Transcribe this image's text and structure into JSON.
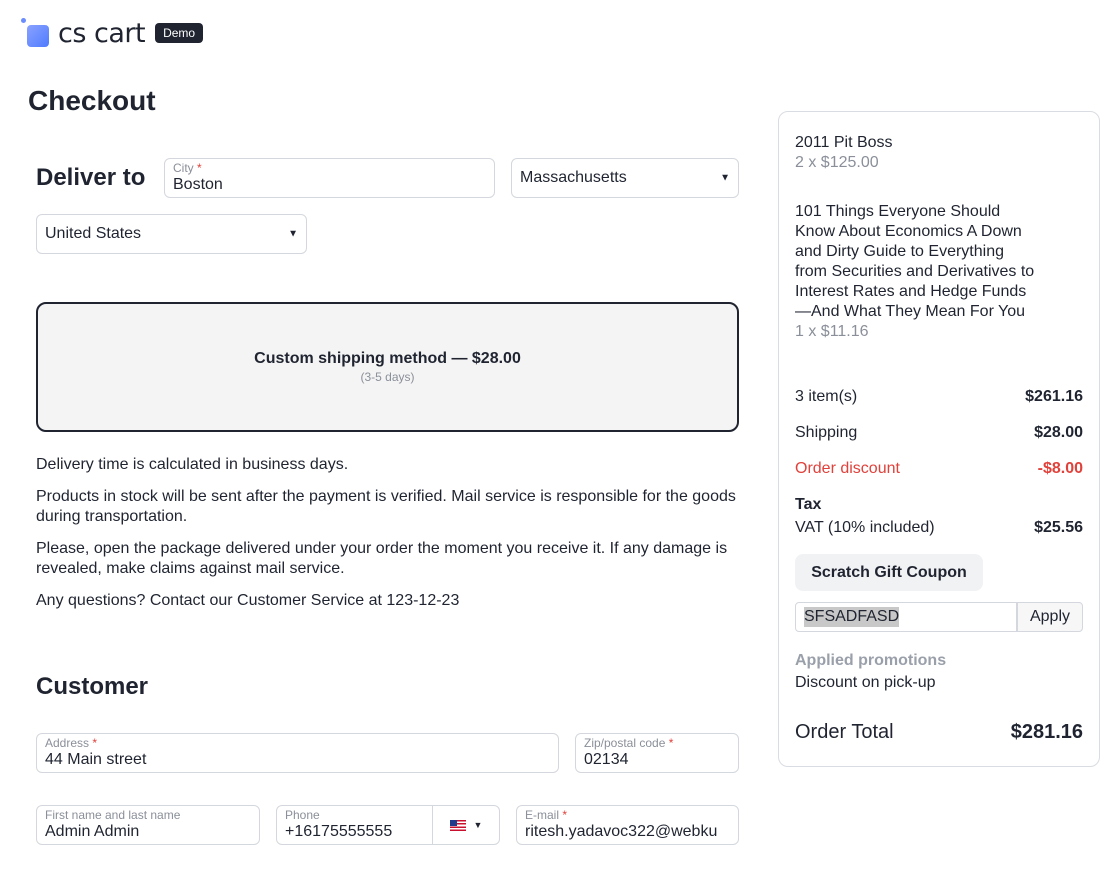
{
  "header": {
    "logo_text": "cs cart",
    "badge": "Demo"
  },
  "page_title": "Checkout",
  "deliver_to": {
    "title": "Deliver to",
    "city": {
      "label": "City",
      "required": "*",
      "value": "Boston"
    },
    "state": {
      "value": "Massachusetts"
    },
    "country": {
      "value": "United States"
    }
  },
  "shipping": {
    "name": "Custom shipping method — $28.00",
    "days": "(3-5 days)"
  },
  "info": [
    "Delivery time is calculated in business days.",
    "Products in stock will be sent after the payment is verified. Mail service is responsible for the goods during transportation.",
    "Please, open the package delivered under your order the moment you receive it. If any damage is revealed, make claims against mail service.",
    "Any questions? Contact our Customer Service at 123-12-23"
  ],
  "customer": {
    "title": "Customer",
    "address": {
      "label": "Address",
      "required": "*",
      "value": "44 Main street"
    },
    "zip": {
      "label": "Zip/postal code",
      "required": "*",
      "value": "02134"
    },
    "name": {
      "label": "First name and last name",
      "value": "Admin Admin"
    },
    "phone": {
      "label": "Phone",
      "value": "+16175555555",
      "flag_icon": "us-flag-icon"
    },
    "email": {
      "label": "E-mail",
      "required": "*",
      "value": "ritesh.yadavoc322@webku"
    }
  },
  "summary": {
    "products": [
      {
        "name": "2011 Pit Boss",
        "qty": "2 x $125.00"
      },
      {
        "name": "101 Things Everyone Should Know About Economics A Down and Dirty Guide to Everything from Securities and Derivatives to Interest Rates and Hedge Funds—And What They Mean For You",
        "qty": "1 x $11.16"
      }
    ],
    "items": {
      "label": "3 item(s)",
      "value": "$261.16"
    },
    "shipping": {
      "label": "Shipping",
      "value": "$28.00"
    },
    "discount": {
      "label": "Order discount",
      "value": "-$8.00"
    },
    "tax_title": "Tax",
    "vat": {
      "label": "VAT (10% included)",
      "value": "$25.56"
    },
    "coupon_button": "Scratch Gift Coupon",
    "coupon_value": "SFSADFASD",
    "apply_label": "Apply",
    "promotions_title": "Applied promotions",
    "promotion": "Discount on pick-up",
    "total": {
      "label": "Order Total",
      "value": "$281.16"
    }
  },
  "colors": {
    "accent_red": "#e0413b",
    "text": "#1f2430",
    "muted": "#8a8f99"
  }
}
